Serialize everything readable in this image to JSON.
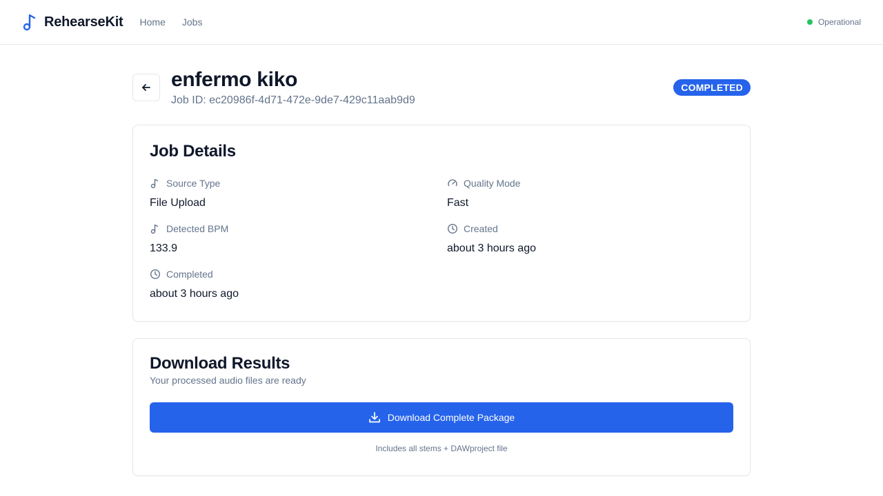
{
  "app": {
    "name": "RehearseKit",
    "nav": [
      {
        "label": "Home"
      },
      {
        "label": "Jobs"
      }
    ],
    "status": {
      "label": "Operational",
      "color": "#22c55e"
    }
  },
  "job": {
    "title": "enfermo kiko",
    "id_text": "Job ID: ec20986f-4d71-472e-9de7-429c11aab9d9",
    "status_badge": "COMPLETED"
  },
  "details": {
    "heading": "Job Details",
    "fields": [
      {
        "label": "Source Type",
        "value": "File Upload",
        "icon": "music-note-icon"
      },
      {
        "label": "Quality Mode",
        "value": "Fast",
        "icon": "gauge-icon"
      },
      {
        "label": "Detected BPM",
        "value": "133.9",
        "icon": "music-note-icon"
      },
      {
        "label": "Created",
        "value": "about 3 hours ago",
        "icon": "clock-icon"
      },
      {
        "label": "Completed",
        "value": "about 3 hours ago",
        "icon": "clock-icon"
      }
    ]
  },
  "download": {
    "heading": "Download Results",
    "subtitle": "Your processed audio files are ready",
    "button_label": "Download Complete Package",
    "note": "Includes all stems + DAWproject file"
  },
  "colors": {
    "accent": "#2563eb",
    "status_ok": "#22c55e"
  }
}
